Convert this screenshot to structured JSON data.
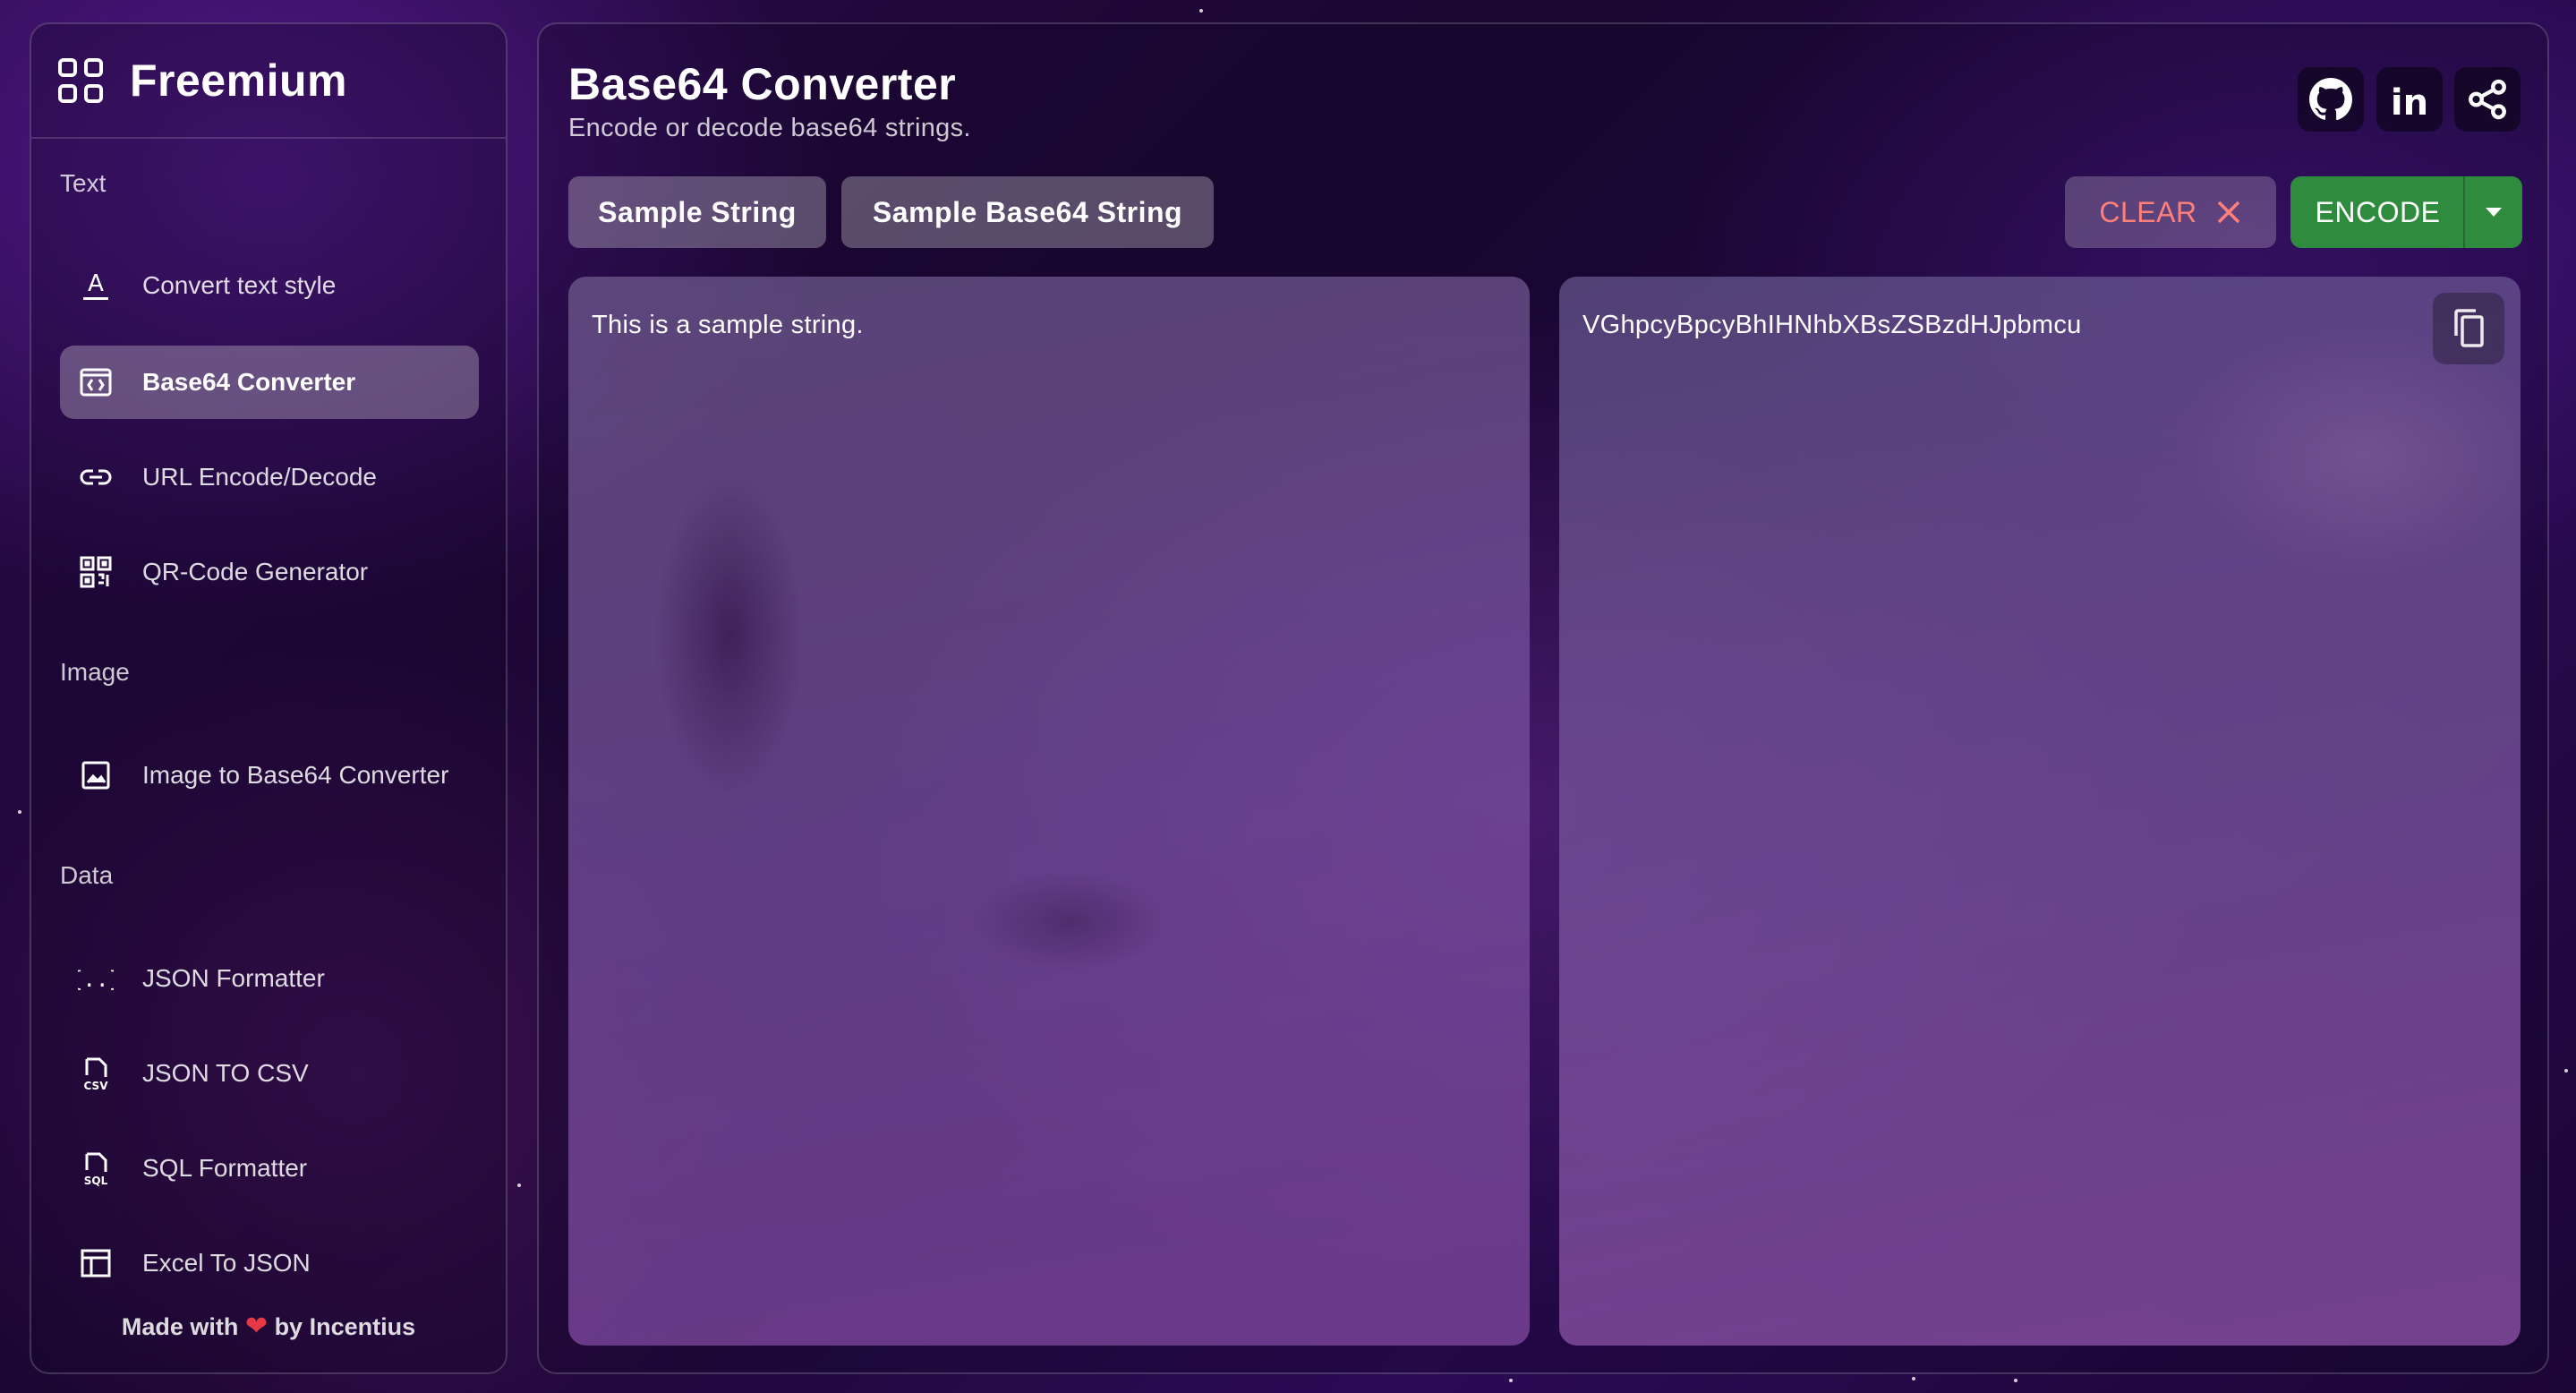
{
  "brand": {
    "name": "Freemium",
    "icon": "grid-icon"
  },
  "sidebar": {
    "sections": [
      {
        "label": "Text"
      },
      {
        "label": "Image"
      },
      {
        "label": "Data"
      }
    ],
    "items": [
      {
        "label": "Convert text style",
        "icon": "text-format-icon",
        "active": false
      },
      {
        "label": "Base64 Converter",
        "icon": "code-window-icon",
        "active": true
      },
      {
        "label": "URL Encode/Decode",
        "icon": "link-icon",
        "active": false
      },
      {
        "label": "QR-Code Generator",
        "icon": "qr-code-icon",
        "active": false
      },
      {
        "label": "Image to Base64 Converter",
        "icon": "image-icon",
        "active": false
      },
      {
        "label": "JSON Formatter",
        "icon": "braces-icon",
        "active": false
      },
      {
        "label": "JSON TO CSV",
        "icon": "csv-file-icon",
        "active": false
      },
      {
        "label": "SQL Formatter",
        "icon": "sql-file-icon",
        "active": false
      },
      {
        "label": "Excel To JSON",
        "icon": "table-icon",
        "active": false
      }
    ],
    "footer": {
      "prefix": "Made with",
      "suffix": "by",
      "author": "Incentius"
    }
  },
  "header": {
    "title": "Base64 Converter",
    "subtitle": "Encode or decode base64 strings.",
    "social": [
      "github-icon",
      "linkedin-icon",
      "share-icon"
    ]
  },
  "toolbar": {
    "sample_string": "Sample String",
    "sample_base64": "Sample Base64 String",
    "clear": "CLEAR",
    "encode": "ENCODE"
  },
  "input": {
    "value": "This is a sample string."
  },
  "output": {
    "value": "VGhpcyBpcyBhIHNhbXBsZSBzdHJpbmcu"
  },
  "colors": {
    "encode": "#2f8b3e",
    "clear_text": "#ff7f7a",
    "heart": "#e53945"
  }
}
